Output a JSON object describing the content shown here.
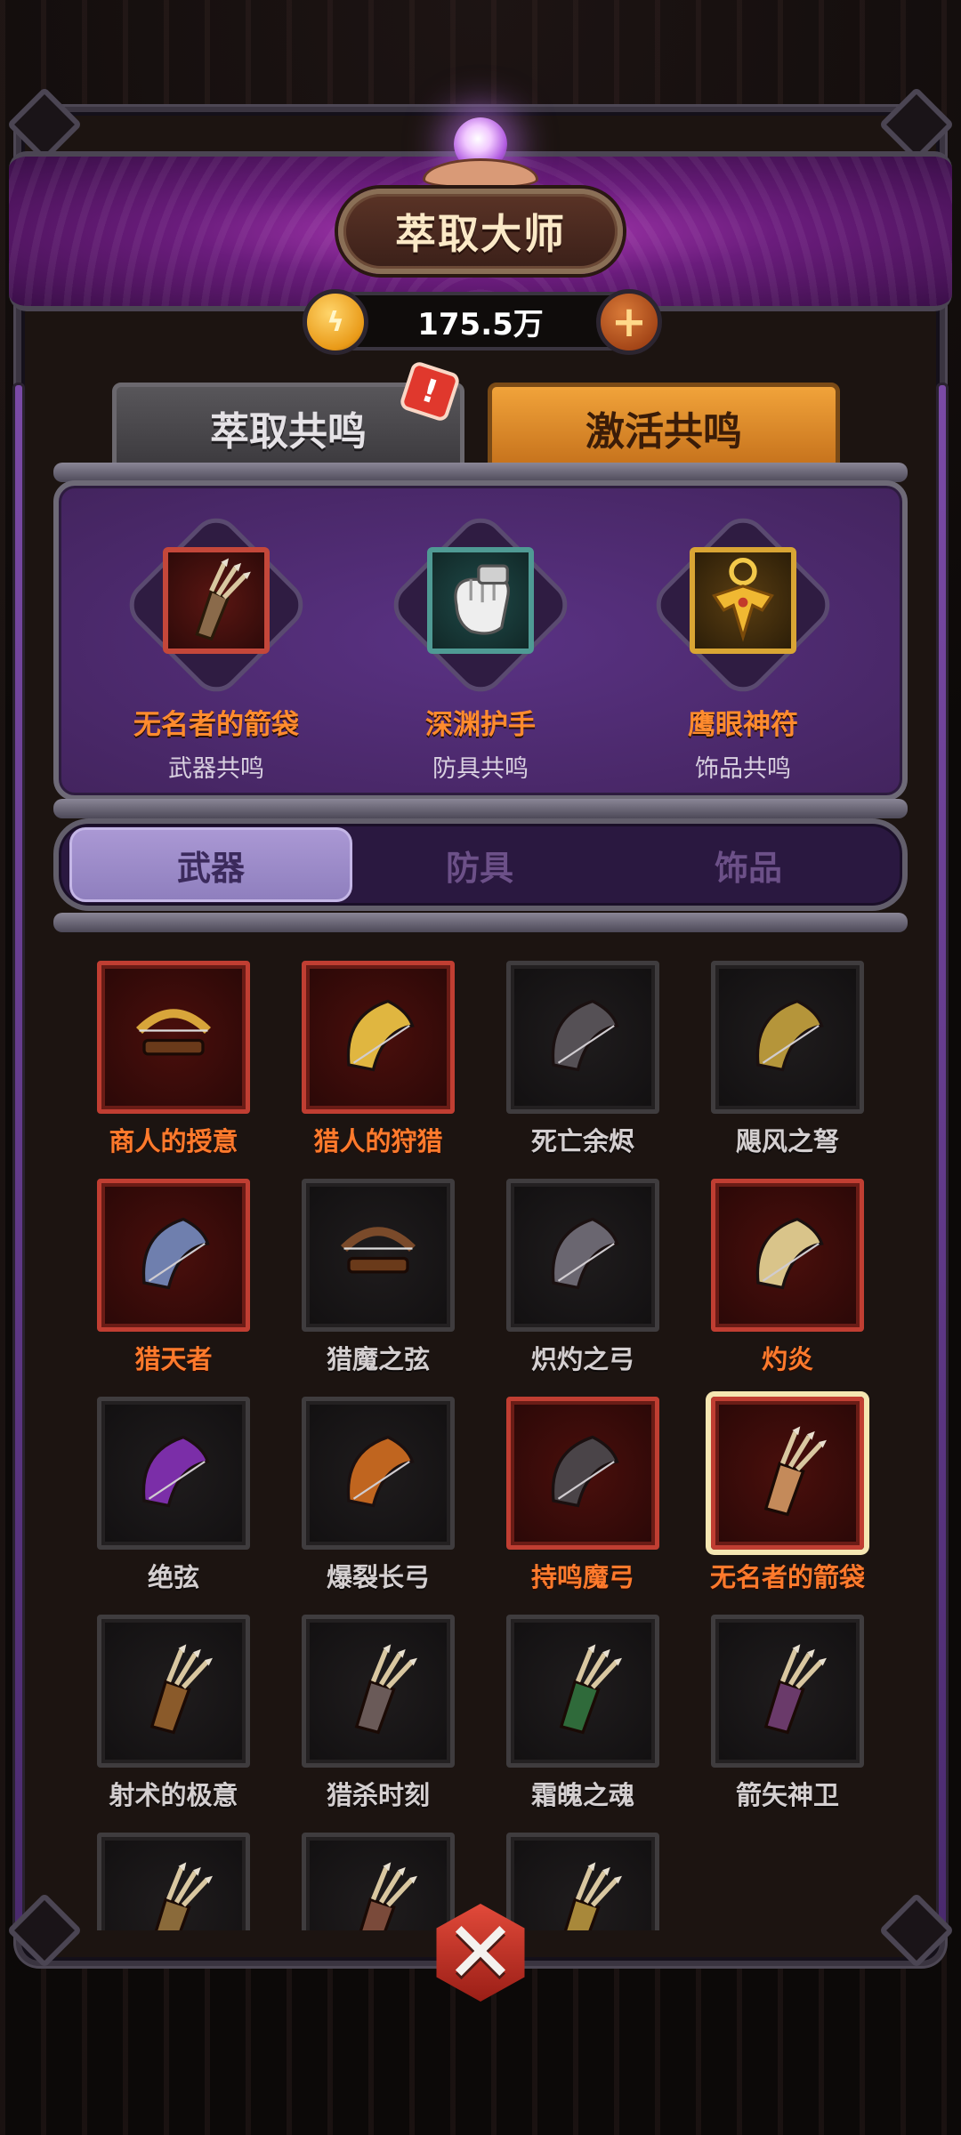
{
  "header": {
    "title": "萃取大师",
    "currency_value": "175.5万",
    "coin_icon": "lightning-coin-icon",
    "plus_icon": "plus-icon"
  },
  "top_tabs": [
    {
      "label": "萃取共鸣",
      "active": false,
      "has_alert": true
    },
    {
      "label": "激活共鸣",
      "active": true
    }
  ],
  "alert_badge": "!",
  "resonance": [
    {
      "name": "无名者的箭袋",
      "type": "武器共鸣",
      "icon": "quiver-icon",
      "rarity": "red"
    },
    {
      "name": "深渊护手",
      "type": "防具共鸣",
      "icon": "gauntlet-icon",
      "rarity": "teal"
    },
    {
      "name": "鹰眼神符",
      "type": "饰品共鸣",
      "icon": "eagle-amulet-icon",
      "rarity": "gold"
    }
  ],
  "category_tabs": [
    {
      "label": "武器",
      "active": true
    },
    {
      "label": "防具",
      "active": false
    },
    {
      "label": "饰品",
      "active": false
    }
  ],
  "items": [
    {
      "name": "商人的授意",
      "rarity": "red",
      "icon": "crossbow-icon",
      "color": "#d8a53a"
    },
    {
      "name": "猎人的狩猎",
      "rarity": "red",
      "icon": "bow-icon",
      "color": "#e0b640"
    },
    {
      "name": "死亡余烬",
      "rarity": "gray",
      "icon": "bow-icon",
      "color": "#555055"
    },
    {
      "name": "飓风之弩",
      "rarity": "gray",
      "icon": "bow-icon",
      "color": "#b5953a"
    },
    {
      "name": "猎天者",
      "rarity": "red",
      "icon": "bow-icon",
      "color": "#6f7fae"
    },
    {
      "name": "猎魔之弦",
      "rarity": "gray",
      "icon": "crossbow-icon",
      "color": "#7a4a2a"
    },
    {
      "name": "炽灼之弓",
      "rarity": "gray",
      "icon": "bow-icon",
      "color": "#6a6670"
    },
    {
      "name": "灼炎",
      "rarity": "red",
      "icon": "bow-icon",
      "color": "#d9c48a"
    },
    {
      "name": "绝弦",
      "rarity": "gray",
      "icon": "bow-icon",
      "color": "#7b2ea8"
    },
    {
      "name": "爆裂长弓",
      "rarity": "gray",
      "icon": "bow-icon",
      "color": "#c0651f"
    },
    {
      "name": "持鸣魔弓",
      "rarity": "red",
      "icon": "bow-icon",
      "color": "#4a4448"
    },
    {
      "name": "无名者的箭袋",
      "rarity": "red",
      "icon": "quiver-icon",
      "color": "#c48a5a",
      "selected": true
    },
    {
      "name": "射术的极意",
      "rarity": "gray",
      "icon": "quiver-icon",
      "color": "#8a5a2a"
    },
    {
      "name": "猎杀时刻",
      "rarity": "gray",
      "icon": "quiver-icon",
      "color": "#6a5a58"
    },
    {
      "name": "霜魄之魂",
      "rarity": "gray",
      "icon": "quiver-icon",
      "color": "#2f6a3a"
    },
    {
      "name": "箭矢神卫",
      "rarity": "gray",
      "icon": "quiver-icon",
      "color": "#6a3a6a"
    },
    {
      "name": "",
      "rarity": "gray",
      "icon": "quiver-icon",
      "color": "#8a6a3a"
    },
    {
      "name": "",
      "rarity": "gray",
      "icon": "quiver-icon",
      "color": "#7a4a3a"
    },
    {
      "name": "",
      "rarity": "gray",
      "icon": "quiver-icon",
      "color": "#a8883a"
    }
  ],
  "close_icon": "close-x-icon"
}
